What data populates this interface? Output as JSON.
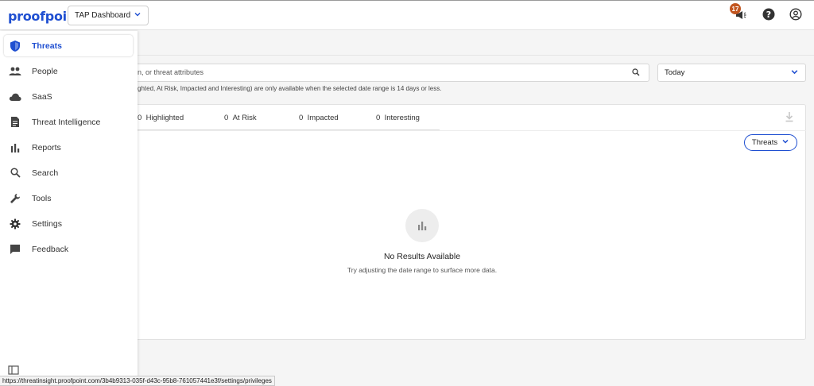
{
  "header": {
    "logo": "proofpoint.",
    "dashboard_select": "TAP Dashboard",
    "notification_count": "17"
  },
  "sidebar": {
    "items": [
      {
        "label": "Threats",
        "icon": "shield-icon"
      },
      {
        "label": "People",
        "icon": "people-icon"
      },
      {
        "label": "SaaS",
        "icon": "cloud-icon"
      },
      {
        "label": "Threat Intelligence",
        "icon": "document-icon"
      },
      {
        "label": "Reports",
        "icon": "bar-chart-icon"
      },
      {
        "label": "Search",
        "icon": "search-icon"
      },
      {
        "label": "Tools",
        "icon": "wrench-icon"
      },
      {
        "label": "Settings",
        "icon": "gear-icon"
      },
      {
        "label": "Feedback",
        "icon": "feedback-icon"
      }
    ]
  },
  "search": {
    "placeholder": "n, or threat attributes"
  },
  "date_filter": {
    "value": "Today"
  },
  "notice": "ghted, At Risk, Impacted and Interesting) are only available when the selected date range is 14 days or less.",
  "tabs": [
    {
      "count": "0",
      "label": "Highlighted"
    },
    {
      "count": "0",
      "label": "At Risk"
    },
    {
      "count": "0",
      "label": "Impacted"
    },
    {
      "count": "0",
      "label": "Interesting"
    }
  ],
  "threats_dropdown": "Threats",
  "empty_state": {
    "title": "No Results Available",
    "subtitle": "Try adjusting the date range to surface more data."
  },
  "status_url": "https://threatinsight.proofpoint.com/3b4b9313-035f-d43c-95b8-761057441e3f/settings/privileges",
  "colors": {
    "brand": "#1f4fd1",
    "badge": "#c2551f"
  }
}
